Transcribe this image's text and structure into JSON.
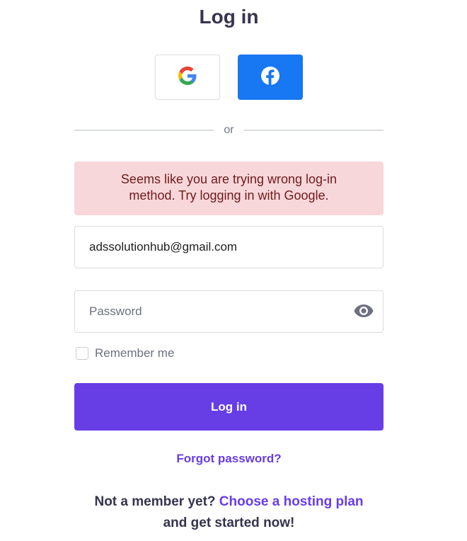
{
  "header": {
    "title": "Log in"
  },
  "social": {
    "google_icon": "google-g-icon",
    "facebook_icon": "facebook-f-icon",
    "facebook_color": "#1877f2"
  },
  "divider": {
    "label": "or"
  },
  "alert": {
    "message": "Seems like you are trying wrong log-in method. Try logging in with Google.",
    "background": "#f8d7da"
  },
  "form": {
    "email_value": "adssolutionhub@gmail.com",
    "password_placeholder": "Password",
    "password_toggle_icon": "eye-icon",
    "remember_label": "Remember me",
    "remember_checked": false,
    "submit_label": "Log in",
    "forgot_label": "Forgot password?"
  },
  "signup": {
    "prefix": "Not a member yet?",
    "link_label": "Choose a hosting plan",
    "suffix": "and get started now!"
  },
  "colors": {
    "accent": "#673de6",
    "title": "#36344d"
  }
}
